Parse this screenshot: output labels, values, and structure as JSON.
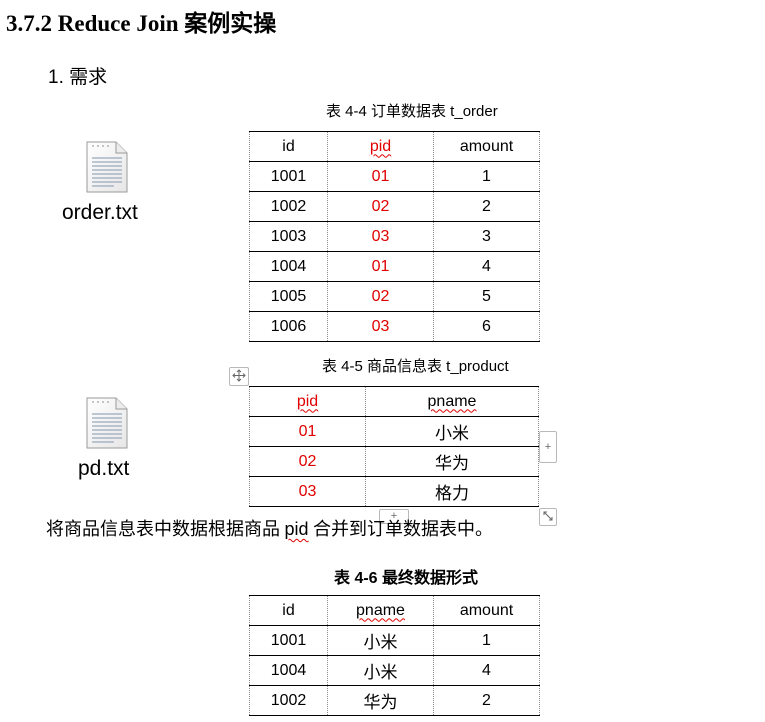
{
  "heading": "3.7.2 Reduce Join 案例实操",
  "requirement": "1.  需求",
  "order_caption": "表 4-4  订单数据表 t_order",
  "order_file": "order.txt",
  "order_table": {
    "headers": [
      "id",
      "pid",
      "amount"
    ],
    "rows": [
      [
        "1001",
        "01",
        "1"
      ],
      [
        "1002",
        "02",
        "2"
      ],
      [
        "1003",
        "03",
        "3"
      ],
      [
        "1004",
        "01",
        "4"
      ],
      [
        "1005",
        "02",
        "5"
      ],
      [
        "1006",
        "03",
        "6"
      ]
    ]
  },
  "product_caption": "表 4-5  商品信息表 t_product",
  "product_file": "pd.txt",
  "product_table": {
    "headers": [
      "pid",
      "pname"
    ],
    "rows": [
      [
        "01",
        "小米"
      ],
      [
        "02",
        "华为"
      ],
      [
        "03",
        "格力"
      ]
    ]
  },
  "instruction": {
    "before": "将商品信息表中数据根据商品 ",
    "keyword": "pid",
    "after": " 合并到订单数据表中。"
  },
  "final_caption": "表 4-6  最终数据形式",
  "final_table": {
    "headers": [
      "id",
      "pname",
      "amount"
    ],
    "rows": [
      [
        "1001",
        "小米",
        "1"
      ],
      [
        "1004",
        "小米",
        "4"
      ],
      [
        "1002",
        "华为",
        "2"
      ]
    ]
  },
  "colors": {
    "highlight": "#e00000",
    "border_dotted": "#8a8a8a"
  },
  "icons": [
    "text-file-icon",
    "move-handle-icon",
    "add-row-icon",
    "add-column-icon",
    "resize-handle-icon"
  ]
}
